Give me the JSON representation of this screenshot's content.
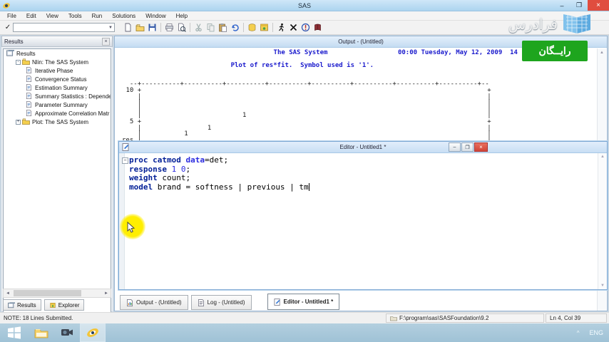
{
  "window": {
    "title": "SAS",
    "controls": {
      "minimize": "–",
      "maximize": "❐",
      "close": "×"
    }
  },
  "menu": {
    "items": [
      "File",
      "Edit",
      "View",
      "Tools",
      "Run",
      "Solutions",
      "Window",
      "Help"
    ]
  },
  "toolbar": {
    "check_glyph": "✓",
    "command_value": "",
    "dropdown_glyph": "▼",
    "icons": [
      "new-file",
      "open",
      "save",
      "sep",
      "print",
      "print-preview",
      "sep",
      "cut",
      "copy",
      "paste",
      "undo",
      "sep",
      "new-library",
      "explorer",
      "sep",
      "submit",
      "clear",
      "break",
      "help"
    ]
  },
  "results_panel": {
    "title": "Results",
    "close_glyph": "×",
    "tree": [
      {
        "label": "Results",
        "level": 0,
        "icon": "results-root",
        "expander": ""
      },
      {
        "label": "Nlin:  The SAS System",
        "level": 1,
        "icon": "results-folder",
        "expander": "-"
      },
      {
        "label": "Iterative Phase",
        "level": 2,
        "icon": "results-doc",
        "expander": ""
      },
      {
        "label": "Convergence Status",
        "level": 2,
        "icon": "results-doc",
        "expander": ""
      },
      {
        "label": "Estimation Summary",
        "level": 2,
        "icon": "results-doc",
        "expander": ""
      },
      {
        "label": "Summary Statistics : Dependen",
        "level": 2,
        "icon": "results-doc",
        "expander": ""
      },
      {
        "label": "Parameter Summary",
        "level": 2,
        "icon": "results-doc",
        "expander": ""
      },
      {
        "label": "Approximate Correlation Matr",
        "level": 2,
        "icon": "results-doc",
        "expander": ""
      },
      {
        "label": "Plot:  The SAS System",
        "level": 1,
        "icon": "results-folder",
        "expander": "+"
      }
    ],
    "scroll": {
      "left": "◄",
      "right": "►"
    },
    "tabs": [
      {
        "label": "Results",
        "icon": "results-root"
      },
      {
        "label": "Explorer",
        "icon": "explorer"
      }
    ]
  },
  "output_window": {
    "title": "Output - (Untitled)",
    "scroll_up": "▲",
    "lines": [
      {
        "row": 0,
        "color": "blue",
        "segs": [
          {
            "col": 39,
            "t": "The SAS System"
          },
          {
            "col": 71,
            "t": "00:00 Tuesday, May 12, 2009  14"
          }
        ]
      },
      {
        "row": 2,
        "color": "blue",
        "segs": [
          {
            "col": 28,
            "t": "Plot of res*fit.  Symbol used is '1'."
          }
        ]
      },
      {
        "row": 5,
        "color": "black",
        "segs": [
          {
            "col": 2,
            "t": "--+----------+----------+----------+----------+----------+----------+----------+----------+--"
          }
        ]
      },
      {
        "row": 6,
        "color": "black",
        "segs": [
          {
            "col": 1,
            "t": "10 +"
          },
          {
            "col": 94,
            "t": "+"
          }
        ]
      },
      {
        "row": 7,
        "color": "black",
        "segs": [
          {
            "col": 4,
            "t": "|"
          },
          {
            "col": 94,
            "t": "|"
          }
        ]
      },
      {
        "row": 8,
        "color": "black",
        "segs": [
          {
            "col": 4,
            "t": "|"
          },
          {
            "col": 94,
            "t": "|"
          }
        ]
      },
      {
        "row": 9,
        "color": "black",
        "segs": [
          {
            "col": 4,
            "t": "|"
          },
          {
            "col": 94,
            "t": "|"
          }
        ]
      },
      {
        "row": 10,
        "color": "black",
        "segs": [
          {
            "col": 4,
            "t": "|"
          },
          {
            "col": 31,
            "t": "1"
          },
          {
            "col": 94,
            "t": "|"
          }
        ]
      },
      {
        "row": 11,
        "color": "black",
        "segs": [
          {
            "col": 2,
            "t": "5"
          },
          {
            "col": 4,
            "t": "+"
          },
          {
            "col": 94,
            "t": "+"
          }
        ]
      },
      {
        "row": 12,
        "color": "black",
        "segs": [
          {
            "col": 4,
            "t": "|"
          },
          {
            "col": 22,
            "t": "1"
          },
          {
            "col": 94,
            "t": "|"
          }
        ]
      },
      {
        "row": 13,
        "color": "black",
        "segs": [
          {
            "col": 4,
            "t": "|"
          },
          {
            "col": 16,
            "t": "1"
          },
          {
            "col": 94,
            "t": "|"
          }
        ]
      },
      {
        "row": 14,
        "color": "black",
        "segs": [
          {
            "col": 0,
            "t": "res"
          },
          {
            "col": 4,
            "t": "|"
          },
          {
            "col": 94,
            "t": "|"
          }
        ]
      }
    ]
  },
  "editor_window": {
    "title": "Editor - Untitled1 *",
    "fold_glyph": "−",
    "scroll": {
      "up": "▲",
      "down": "▼"
    },
    "code_lines": [
      [
        {
          "t": "proc catmod ",
          "c": "kw"
        },
        {
          "t": "data",
          "c": "kw2"
        },
        {
          "t": "=det;",
          "c": "plain"
        }
      ],
      [
        {
          "t": "response ",
          "c": "kw"
        },
        {
          "t": "1 0",
          "c": "num"
        },
        {
          "t": ";",
          "c": "plain"
        }
      ],
      [
        {
          "t": "weight ",
          "c": "kw"
        },
        {
          "t": "count;",
          "c": "plain"
        }
      ],
      [
        {
          "t": "model ",
          "c": "kw"
        },
        {
          "t": "brand = softness | previous | tm",
          "c": "plain"
        }
      ]
    ],
    "cursor_line": 3
  },
  "window_tabs": [
    {
      "label": "Output - (Untitled)",
      "icon": "tab-output",
      "active": false
    },
    {
      "label": "Log - (Untitled)",
      "icon": "tab-log",
      "active": false
    },
    {
      "label": "Editor - Untitled1 *",
      "icon": "tab-editor",
      "active": true
    }
  ],
  "status_bar": {
    "note": "NOTE: 18 Lines Submitted.",
    "path": "F:\\program\\sas\\SASFoundation\\9.2",
    "position": "Ln 4, Col 39"
  },
  "taskbar": {
    "buttons": [
      "start",
      "file-explorer",
      "camera",
      "sas"
    ],
    "active_button": "sas",
    "tray": {
      "caret": "^",
      "lang": "ENG"
    }
  },
  "watermark": {
    "brand_text": "فرادرس",
    "badge_text": "رایــگان",
    "badge_color": "#1ea51e"
  }
}
